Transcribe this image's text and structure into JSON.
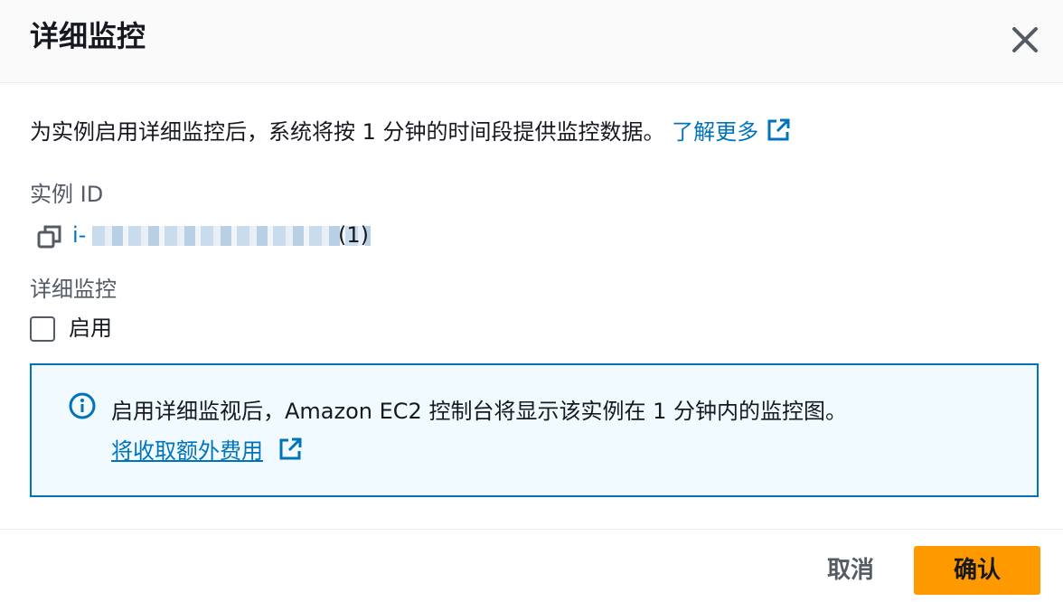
{
  "dialog": {
    "title": "详细监控",
    "description": "为实例启用详细监控后，系统将按 1 分钟的时间段提供监控数据。",
    "learn_more_link": "了解更多",
    "instance_label": "实例 ID",
    "instance_id_prefix": "i-",
    "instance_count": "(1)",
    "monitoring_label": "详细监控",
    "enable_checkbox_label": "启用",
    "enable_checked": false,
    "info_text": "启用详细监视后，Amazon EC2 控制台将显示该实例在 1 分钟内的监控图。",
    "info_link": "将收取额外费用",
    "cancel_label": "取消",
    "confirm_label": "确认"
  },
  "icons": {
    "close": "close-icon",
    "external": "external-link-icon",
    "copy": "copy-icon",
    "info": "info-icon"
  },
  "colors": {
    "link": "#0073bb",
    "primary_button": "#ff9900",
    "info_background": "#f1faff",
    "info_border": "#0073bb"
  }
}
